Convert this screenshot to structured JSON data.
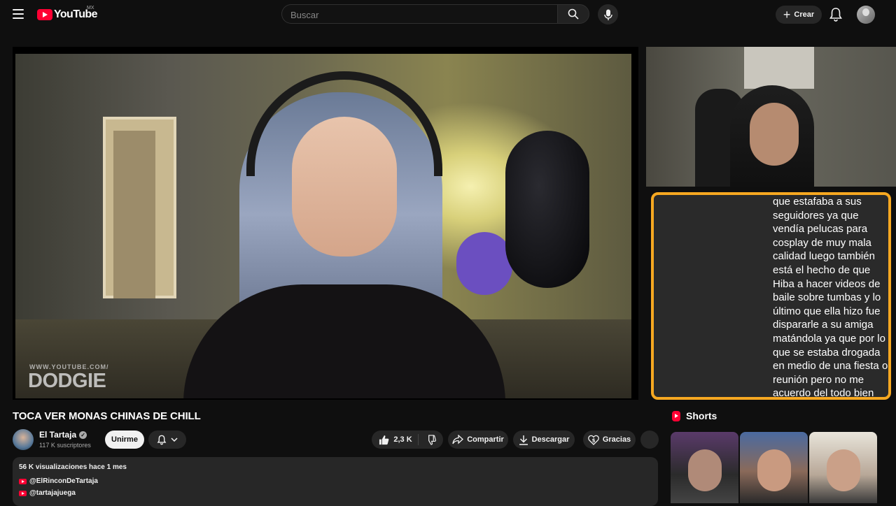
{
  "header": {
    "logo_text": "YouTube",
    "region": "MX",
    "search_placeholder": "Buscar",
    "create_label": "Crear"
  },
  "player": {
    "watermark_small": "WWW.YOUTUBE.COM/",
    "watermark_big": "DODGIE",
    "caption": "que estafaba a sus\nseguidores ya que\nvendía pelucas para\ncosplay de muy mala\ncalidad luego también\nestá el hecho de que\nHiba a hacer videos de\nbaile sobre tumbas y lo\núltimo que ella hizo fue\ndispararle a su amiga\nmatándola ya que por lo\nque se estaba drogada\nen medio de una fiesta o\nreunión pero no me\nacuerdo del todo bien",
    "caption_border_color": "#f6a821"
  },
  "video": {
    "title": "TOCA VER MONAS CHINAS DE CHILL",
    "channel_name": "El Tartaja",
    "subscribers": "117 K suscriptores",
    "join_label": "Unirme",
    "like_count": "2,3 K",
    "share_label": "Compartir",
    "download_label": "Descargar",
    "thanks_label": "Gracias"
  },
  "description": {
    "stats": "56 K visualizaciones  hace 1 mes",
    "links": [
      "@ElRinconDeTartaja",
      "@tartajajuega"
    ]
  },
  "shorts": {
    "heading": "Shorts"
  },
  "colors": {
    "brand_red": "#ff0033",
    "background": "#0f0f0f",
    "pill": "#272727"
  }
}
